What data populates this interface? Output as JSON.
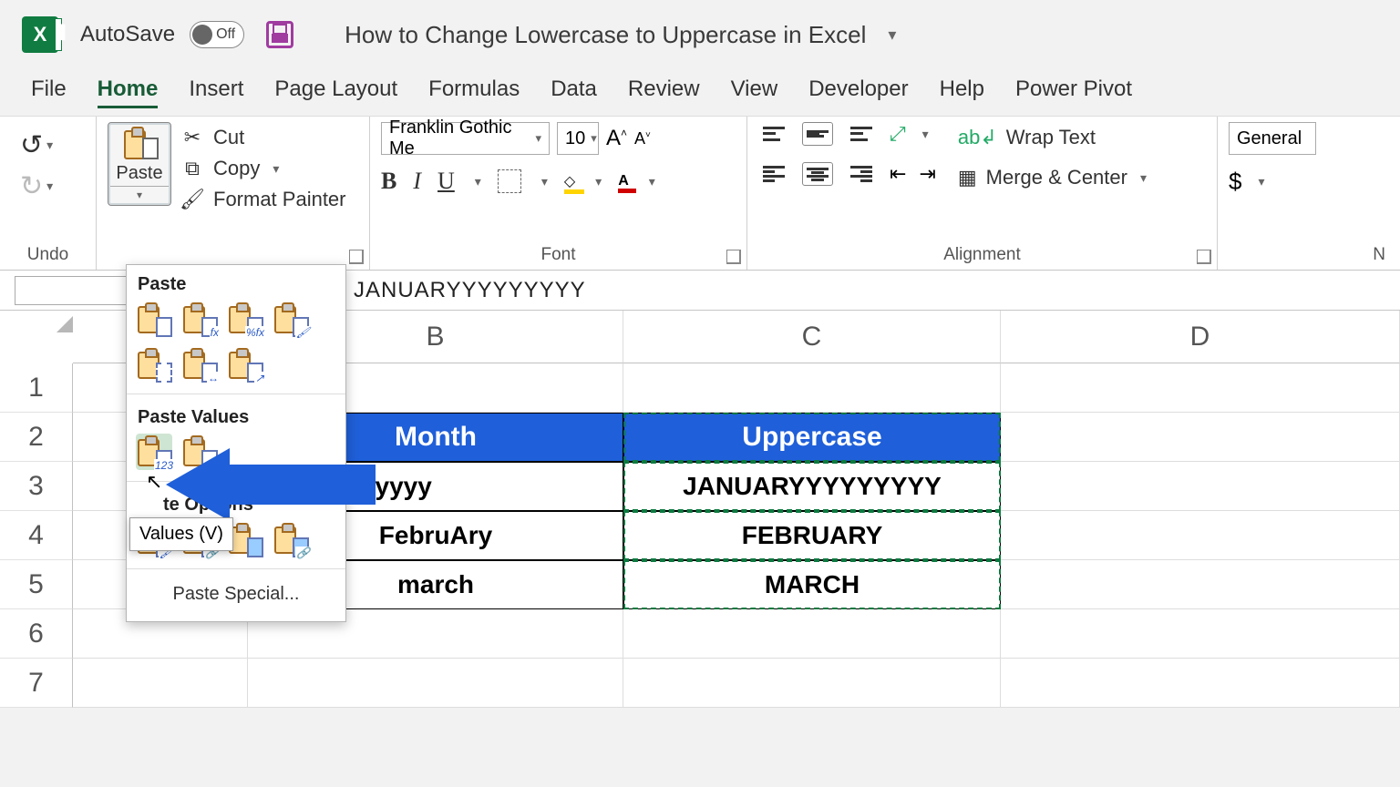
{
  "titlebar": {
    "autosave_label": "AutoSave",
    "autosave_state": "Off",
    "doc_title": "How to Change Lowercase to Uppercase in Excel"
  },
  "tabs": [
    "File",
    "Home",
    "Insert",
    "Page Layout",
    "Formulas",
    "Data",
    "Review",
    "View",
    "Developer",
    "Help",
    "Power Pivot"
  ],
  "active_tab": "Home",
  "ribbon": {
    "undo_group": "Undo",
    "paste_label": "Paste",
    "cut": "Cut",
    "copy": "Copy",
    "format_painter": "Format Painter",
    "font_group": "Font",
    "font_name": "Franklin Gothic Me",
    "font_size": "10",
    "alignment_group": "Alignment",
    "wrap_text": "Wrap Text",
    "merge_center": "Merge & Center",
    "number_format": "General",
    "number_label_trunc": "N"
  },
  "formula_bar": {
    "value": "JANUARYYYYYYYYY"
  },
  "columns": [
    "B",
    "C",
    "D"
  ],
  "rows": [
    "1",
    "2",
    "3",
    "4",
    "5",
    "6",
    "7"
  ],
  "sheet": {
    "B2": "Month",
    "C2": "Uppercase",
    "B3": "nuaryyyyyyyyy",
    "C3": "JANUARYYYYYYYYY",
    "B4": "FebruAry",
    "C4": "FEBRUARY",
    "B5": "march",
    "C5": "MARCH"
  },
  "paste_menu": {
    "section_paste": "Paste",
    "section_values": "Paste Values",
    "section_other_suffix": "te Options",
    "special": "Paste Special...",
    "tooltip": "Values (V)"
  }
}
